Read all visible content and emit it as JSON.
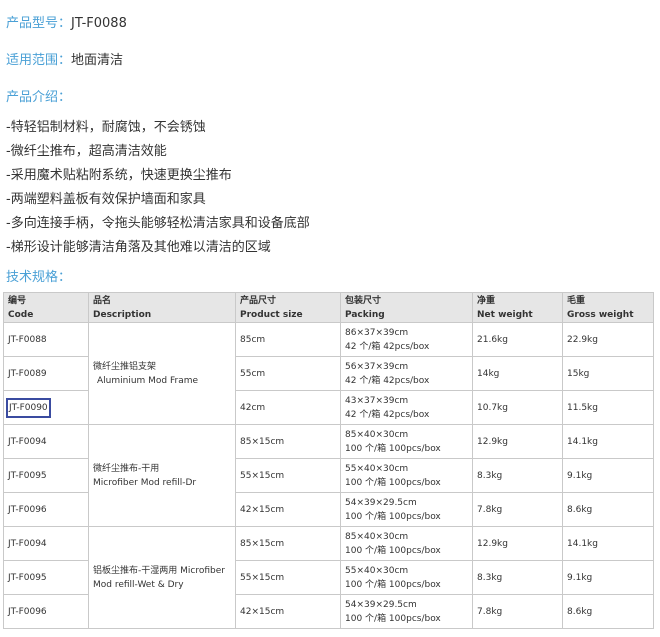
{
  "model": {
    "label": "产品型号：",
    "value": "JT-F0088"
  },
  "scope": {
    "label": "适用范围：",
    "value": "地面清洁"
  },
  "intro_heading": "产品介绍：",
  "features": [
    "-特轻铝制材料，耐腐蚀，不会锈蚀",
    "-微纤尘推布，超高清洁效能",
    "-采用魔术贴粘附系统，快速更换尘推布",
    "-两端塑料盖板有效保护墙面和家具",
    "-多向连接手柄，令拖头能够轻松清洁家具和设备底部",
    "-梯形设计能够清洁角落及其他难以清洁的区域"
  ],
  "spec_heading": "技术规格：",
  "table": {
    "headers": [
      {
        "cn": "编号",
        "en": "Code"
      },
      {
        "cn": "品名",
        "en": "Description"
      },
      {
        "cn": "产品尺寸",
        "en": "Product size"
      },
      {
        "cn": "包装尺寸",
        "en": "Packing"
      },
      {
        "cn": "净重",
        "en": "Net weight"
      },
      {
        "cn": "毛重",
        "en": "Gross weight"
      }
    ],
    "groups": [
      {
        "name_cn": "微纤尘推铝支架",
        "name_en": "Aluminium Mod Frame"
      },
      {
        "name_cn": "微纤尘推布-干用",
        "name_en": "Microfiber Mod refill-Dr"
      },
      {
        "name_cn": "铝板尘推布-干湿两用 Microfiber",
        "name_en": "Mod refill-Wet & Dry"
      }
    ],
    "rows": [
      {
        "code": "JT-F0088",
        "size": "85cm",
        "pack1": "86×37×39cm",
        "pack2": "42 个/箱 42pcs/box",
        "net": "21.6kg",
        "gross": "22.9kg"
      },
      {
        "code": "JT-F0089",
        "size": "55cm",
        "pack1": "56×37×39cm",
        "pack2": "42 个/箱 42pcs/box",
        "net": "14kg",
        "gross": "15kg"
      },
      {
        "code": "JT-F0090",
        "size": "42cm",
        "pack1": "43×37×39cm",
        "pack2": "42 个/箱 42pcs/box",
        "net": "10.7kg",
        "gross": "11.5kg"
      },
      {
        "code": "JT-F0094",
        "size": "85×15cm",
        "pack1": "85×40×30cm",
        "pack2": "100 个/箱 100pcs/box",
        "net": "12.9kg",
        "gross": "14.1kg"
      },
      {
        "code": "JT-F0095",
        "size": "55×15cm",
        "pack1": "55×40×30cm",
        "pack2": "100 个/箱 100pcs/box",
        "net": "8.3kg",
        "gross": "9.1kg"
      },
      {
        "code": "JT-F0096",
        "size": "42×15cm",
        "pack1": "54×39×29.5cm",
        "pack2": "100 个/箱 100pcs/box",
        "net": "7.8kg",
        "gross": "8.6kg"
      },
      {
        "code": "JT-F0094",
        "size": "85×15cm",
        "pack1": "85×40×30cm",
        "pack2": "100 个/箱 100pcs/box",
        "net": "12.9kg",
        "gross": "14.1kg"
      },
      {
        "code": "JT-F0095",
        "size": "55×15cm",
        "pack1": "55×40×30cm",
        "pack2": "100 个/箱 100pcs/box",
        "net": "8.3kg",
        "gross": "9.1kg"
      },
      {
        "code": "JT-F0096",
        "size": "42×15cm",
        "pack1": "54×39×29.5cm",
        "pack2": "100 个/箱 100pcs/box",
        "net": "7.8kg",
        "gross": "8.6kg"
      }
    ]
  }
}
